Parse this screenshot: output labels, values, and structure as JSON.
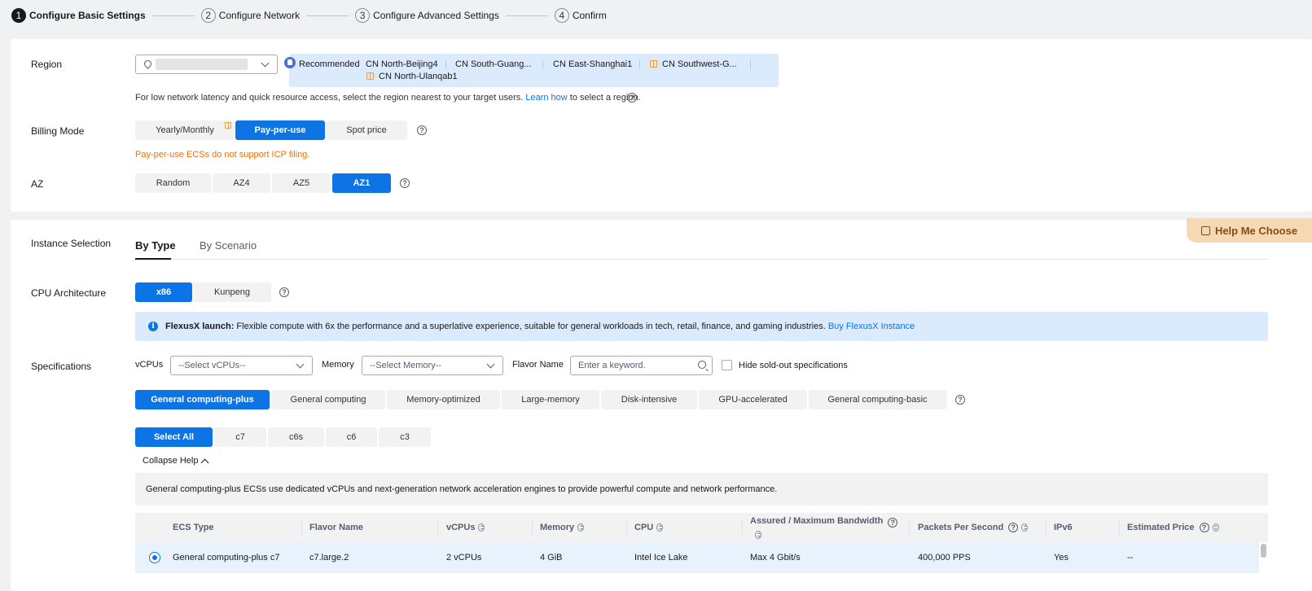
{
  "steps": [
    {
      "num": "1",
      "label": "Configure Basic Settings"
    },
    {
      "num": "2",
      "label": "Configure Network"
    },
    {
      "num": "3",
      "label": "Configure Advanced Settings"
    },
    {
      "num": "4",
      "label": "Confirm"
    }
  ],
  "region": {
    "label": "Region",
    "recommended_label": "Recommended",
    "regions": [
      "CN North-Beijing4",
      "CN South-Guang...",
      "CN East-Shanghai1",
      "CN Southwest-G...",
      "CN North-Ulanqab1"
    ],
    "hint_prefix": "For low network latency and quick resource access, select the region nearest to your target users.",
    "hint_link": "Learn how",
    "hint_suffix": "to select a region."
  },
  "billing": {
    "label": "Billing Mode",
    "options": [
      "Yearly/Monthly",
      "Pay-per-use",
      "Spot price"
    ],
    "selected": "Pay-per-use",
    "warning": "Pay-per-use ECSs do not support ICP filing."
  },
  "az": {
    "label": "AZ",
    "options": [
      "Random",
      "AZ4",
      "AZ5",
      "AZ1"
    ],
    "selected": "AZ1"
  },
  "instance": {
    "label": "Instance Selection",
    "tabs": [
      "By Type",
      "By Scenario"
    ],
    "help_choose": "Help Me Choose"
  },
  "cpu_arch": {
    "label": "CPU Architecture",
    "options": [
      "x86",
      "Kunpeng"
    ],
    "selected": "x86"
  },
  "flexus": {
    "title": "FlexusX launch:",
    "text": "Flexible compute with 6x the performance and a superlative experience, suitable for general workloads in tech, retail, finance, and gaming industries.",
    "link": "Buy FlexusX Instance"
  },
  "specs": {
    "label": "Specifications",
    "vcpus_label": "vCPUs",
    "vcpus_placeholder": "--Select vCPUs--",
    "memory_label": "Memory",
    "memory_placeholder": "--Select Memory--",
    "flavor_label": "Flavor Name",
    "flavor_placeholder": "Enter a keyword.",
    "hide_soldout": "Hide sold-out specifications",
    "categories": [
      "General computing-plus",
      "General computing",
      "Memory-optimized",
      "Large-memory",
      "Disk-intensive",
      "GPU-accelerated",
      "General computing-basic"
    ],
    "families": [
      "Select All",
      "c7",
      "c6s",
      "c6",
      "c3"
    ],
    "collapse_help": "Collapse Help",
    "help_text": "General computing-plus ECSs use dedicated vCPUs and next-generation network acceleration engines to provide powerful compute and network performance."
  },
  "table": {
    "headers": [
      "ECS Type",
      "Flavor Name",
      "vCPUs",
      "Memory",
      "CPU",
      "Assured / Maximum Bandwidth",
      "Packets Per Second",
      "IPv6",
      "Estimated Price"
    ],
    "row": [
      "General computing-plus c7",
      "c7.large.2",
      "2 vCPUs",
      "4 GiB",
      "Intel Ice Lake",
      "Max 4 Gbit/s",
      "400,000 PPS",
      "Yes",
      "--"
    ]
  },
  "colors": {
    "accent": "#0d74e5",
    "warning": "#f66f07",
    "info_bg": "#dbeafd"
  }
}
